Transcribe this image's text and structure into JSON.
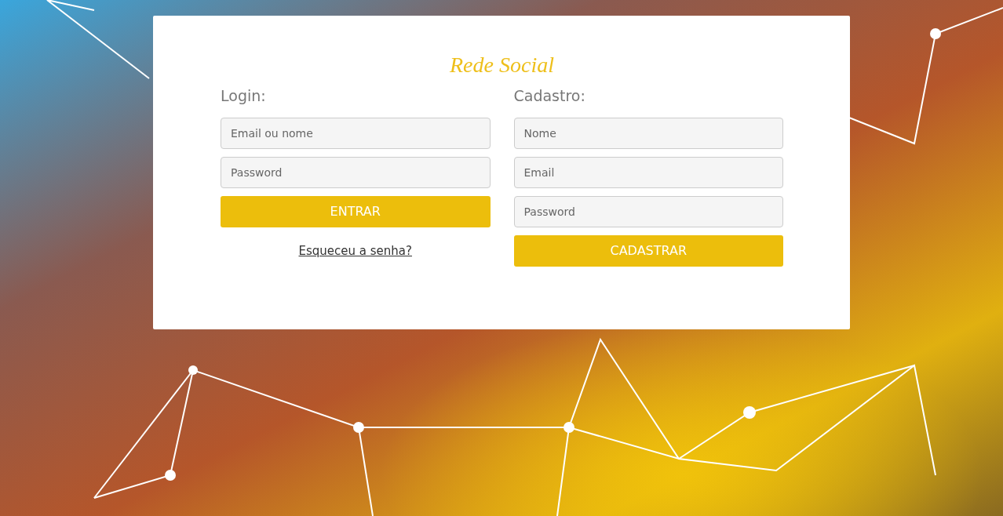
{
  "title": "Rede Social",
  "login": {
    "heading": "Login:",
    "fields": [
      {
        "placeholder": "Email ou nome"
      },
      {
        "placeholder": "Password"
      }
    ],
    "button": "ENTRAR",
    "link": "Esqueceu a senha?"
  },
  "signup": {
    "heading": "Cadastro:",
    "fields": [
      {
        "placeholder": "Nome"
      },
      {
        "placeholder": "Email"
      },
      {
        "placeholder": "Password"
      }
    ],
    "button": "CADASTRAR"
  }
}
